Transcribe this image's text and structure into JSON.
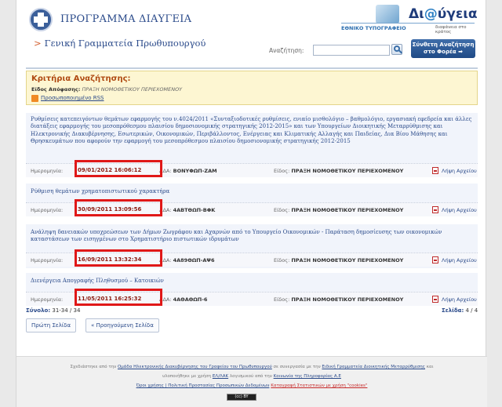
{
  "header": {
    "program_title": "ΠΡΟΓΡΑΜΜΑ ΔΙΑΥΓΕΙΑ",
    "brand_prefix": "Δι",
    "brand_at": "@",
    "brand_suffix": "ύγεια",
    "brand_sub1": "ΕΘΝΙΚΟ ΤΥΠΟΓΡΑΦΕΙΟ",
    "brand_sub2": "διαφάνεια στο κράτος",
    "secretariat": "Γενική Γραμματεία Πρωθυπουργού",
    "search_label": "Αναζήτηση:",
    "search_value": "",
    "compose_line1": "Σύνθετη Αναζήτηση",
    "compose_line2": "στο Φορέα ➡"
  },
  "criteria": {
    "title": "Κριτήρια Αναζήτησης:",
    "type_label": "Είδος Απόφασης:",
    "type_value": "ΠΡΑΞΗ ΝΟΜΟΘΕΤΙΚΟΥ ΠΕΡΙΕΧΟΜΕΝΟΥ",
    "rss_label": "Προσωποποιημένο RSS"
  },
  "results": [
    {
      "title": "Ρυθμίσεις κατεπειγόντων θεμάτων εφαρμογής του ν.4024/2011 «Συνταξιοδοτικές ρυθμίσεις, ενιαίο μισθολόγιο – βαθμολόγιο, εργασιακή εφεδρεία και άλλες διατάξεις εφαρμογής του μεσοπρόθεσμου πλαισίου δημοσιονομικής στρατηγικής 2012-2015» και των Υπουργείων Διοικητικής Μεταρρύθμισης και Ηλεκτρονικής Διακυβέρνησης, Εσωτερικών, Οικονομικών, Περιβάλλοντος, Ενέργειας και Κλιματικής Αλλαγής και Παιδείας, Δια Βίου Μάθησης και Θρησκευμάτων που αφορούν την εφαρμογή του μεσοπρόθεσμου πλαισίου δημοσιονομικής στρατηγικής 2012-2015",
      "date_label": "Ημερομηνία:",
      "date": "09/01/2012 16:06:12",
      "ada_label": "ΑΔΑ:",
      "ada": "ΒΟΝΥΦΩΠ-ΖΑΜ",
      "kind_label": "Είδος:",
      "kind": "ΠΡΑΞΗ ΝΟΜΟΘΕΤΙΚΟΥ ΠΕΡΙΕΧΟΜΕΝΟΥ",
      "download": "Λήψη Αρχείου"
    },
    {
      "title": "Ρύθμιση θεμάτων χρηματοπιστωτικού χαρακτήρα",
      "date_label": "Ημερομηνία:",
      "date": "30/09/2011 13:09:56",
      "ada_label": "ΑΔΑ:",
      "ada": "4ΑΒΤΘΩΠ-ΒΦΚ",
      "kind_label": "Είδος:",
      "kind": "ΠΡΑΞΗ ΝΟΜΟΘΕΤΙΚΟΥ ΠΕΡΙΕΧΟΜΕΝΟΥ",
      "download": "Λήψη Αρχείου"
    },
    {
      "title": "Ανάληψη δανειακών υποχρεώσεων των Δήμων Ζωγράφου και Αχαρνών από το Υπουργείο Οικονομικών - Παράταση δημοσίευσης των οικονομικών καταστάσεων των εισηγμένων στο Χρηματιστήριο πιστωτικών ιδρυμάτων",
      "date_label": "Ημερομηνία:",
      "date": "16/09/2011 13:32:34",
      "ada_label": "ΑΔΑ:",
      "ada": "4Α89ΘΩΠ-ΑΨ6",
      "kind_label": "Είδος:",
      "kind": "ΠΡΑΞΗ ΝΟΜΟΘΕΤΙΚΟΥ ΠΕΡΙΕΧΟΜΕΝΟΥ",
      "download": "Λήψη Αρχείου"
    },
    {
      "title": "Διενέργεια Απογραφής Πληθυσμού – Κατοικιών",
      "date_label": "Ημερομηνία:",
      "date": "11/05/2011 16:25:32",
      "ada_label": "ΑΔΑ:",
      "ada": "4ΑΘΑΘΩΠ-6",
      "kind_label": "Είδος:",
      "kind": "ΠΡΑΞΗ ΝΟΜΟΘΕΤΙΚΟΥ ΠΕΡΙΕΧΟΜΕΝΟΥ",
      "download": "Λήψη Αρχείου"
    }
  ],
  "summary": {
    "total_label": "Σύνολο:",
    "total_value": "31-34 / 34",
    "pages_label": "Σελίδα:",
    "pages_value": "4 / 4"
  },
  "pager": {
    "first": "Πρώτη Σελίδα",
    "prev": "« Προηγούμενη Σελίδα"
  },
  "footer": {
    "l1_a": "Σχεδιάστηκε από την",
    "l1_link1": "Ομάδα Ηλεκτρονικής Διακυβέρνησης του Γραφείου του Πρωθυπουργού",
    "l1_b": "σε συνεργασία με την",
    "l1_link2": "Ειδική Γραμματεία Διοικητικής Μεταρρύθμισης",
    "l1_c": "και",
    "l2_a": "υλοποιήθηκε με χρήση",
    "l2_link1": "ΕΛ/ΛΑΚ",
    "l2_b": "λογισμικού από την",
    "l2_link2": "Κοινωνία της Πληροφορίας Α.Ε",
    "l3_link1": "Όροι χρήσης | Πολιτική Προστασίας Προσωπικών Δεδομένων",
    "l3_link2": "Καταγραφή Στατιστικών με χρήση \"cookies\"",
    "cc": "(cc) BY"
  },
  "colors": {
    "highlight": "#e01818",
    "link": "#2a4a8a",
    "accent": "#b04b13"
  }
}
